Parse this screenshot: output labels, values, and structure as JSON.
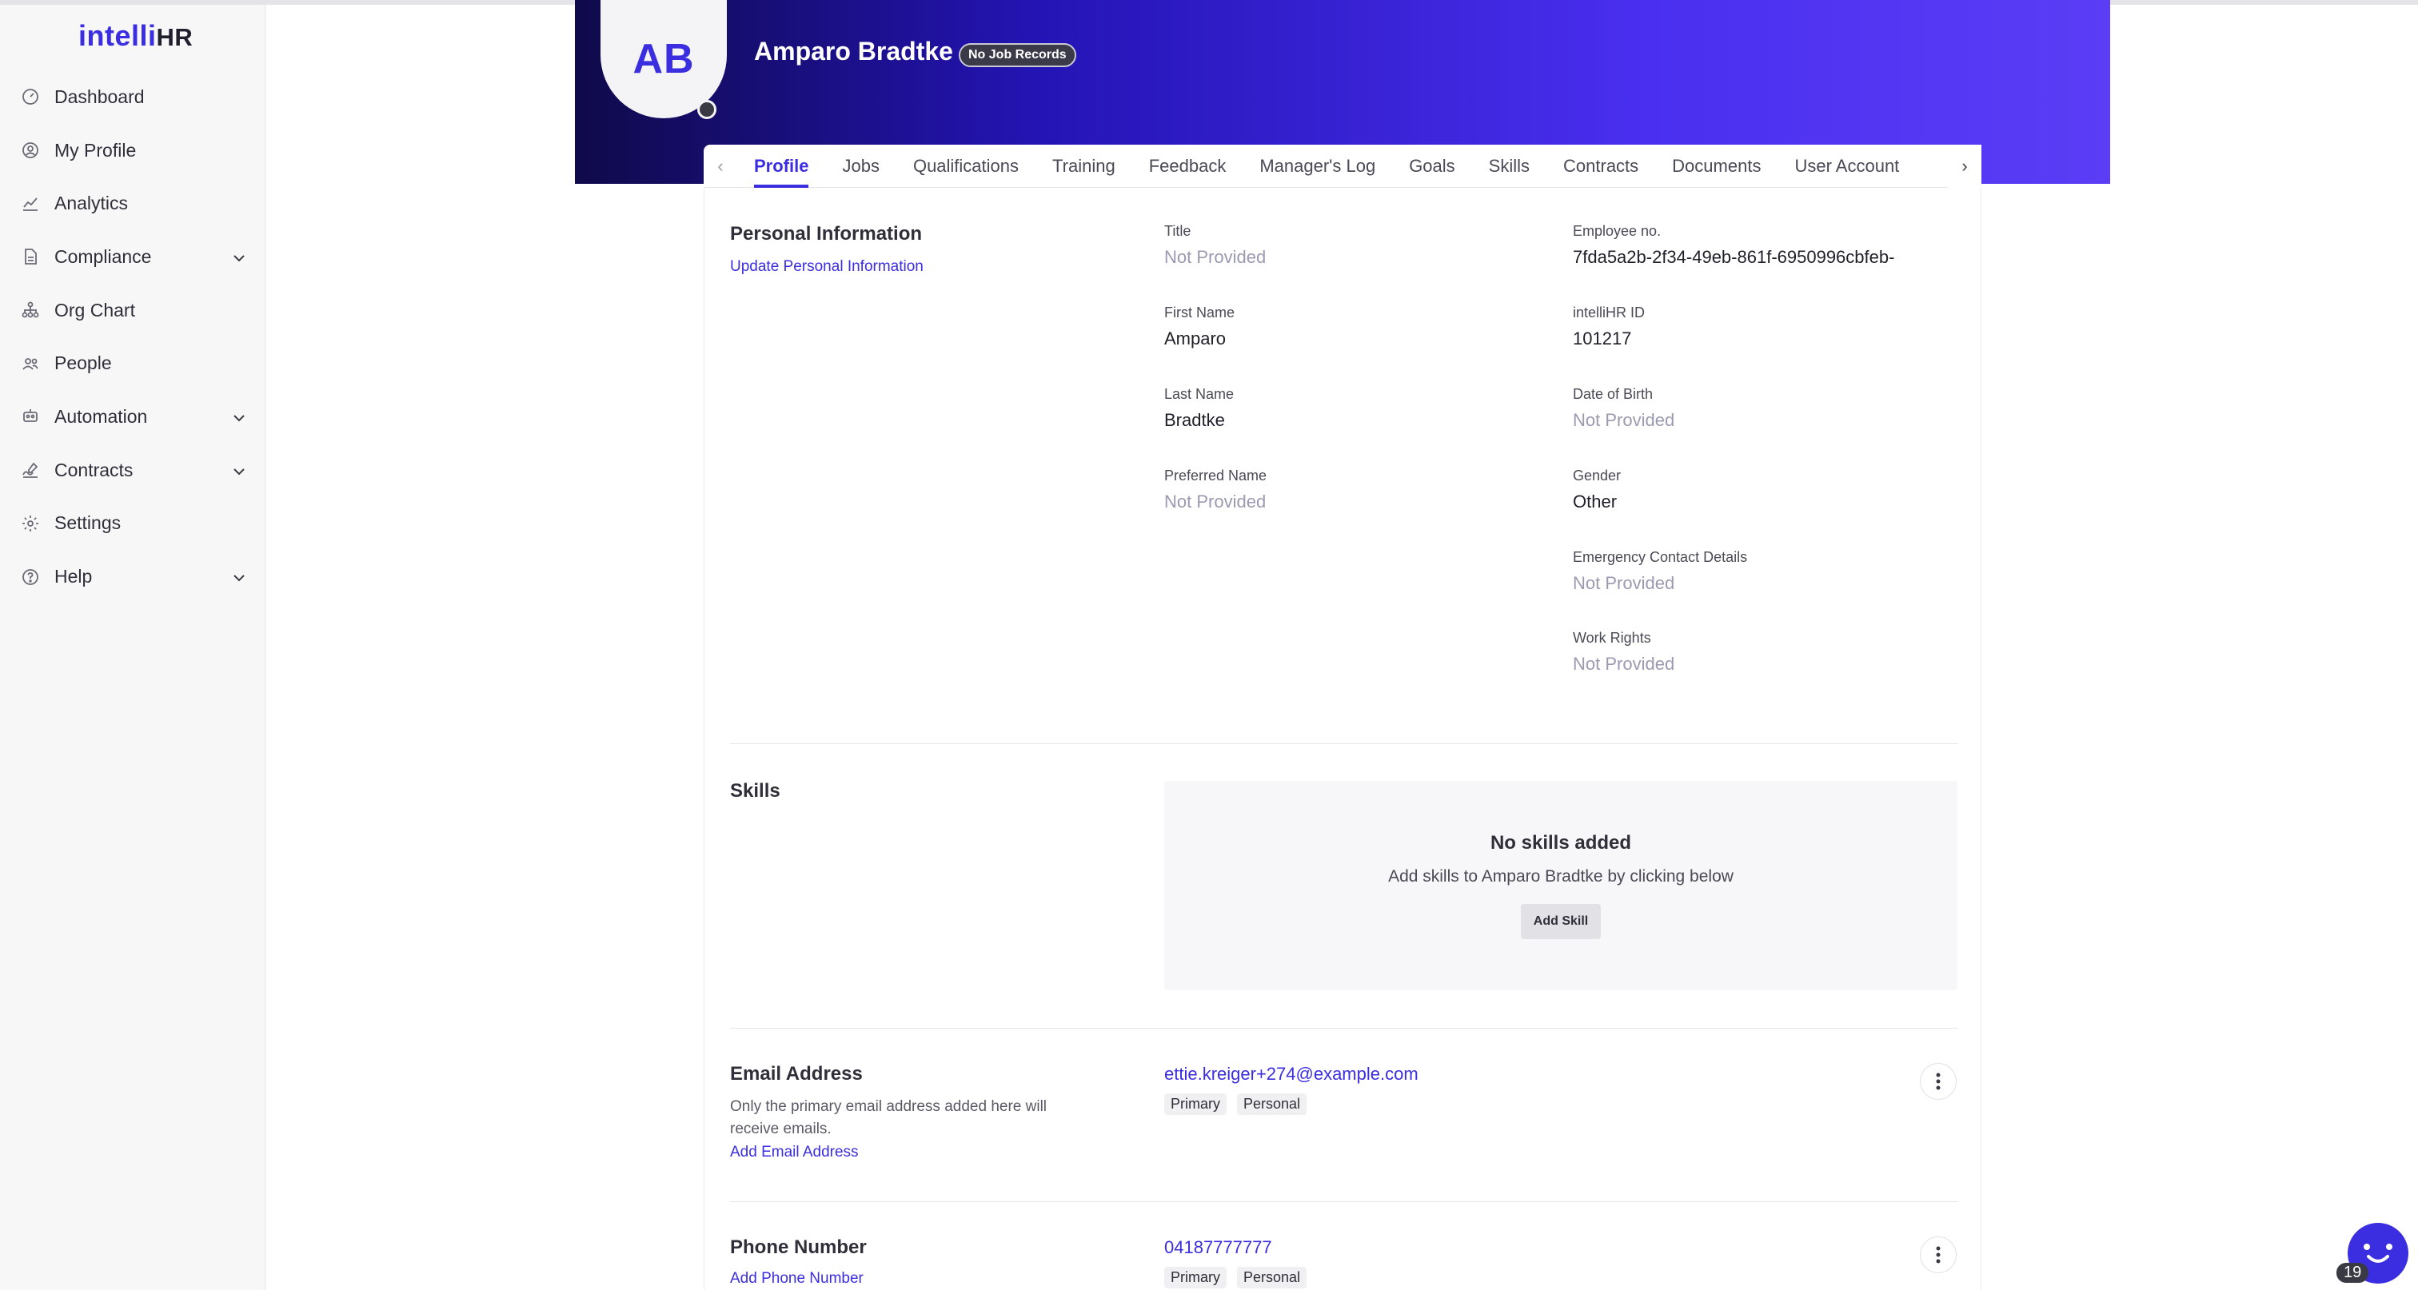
{
  "app": {
    "logo_primary": "intelli",
    "logo_secondary": "HR"
  },
  "sidebar": {
    "items": [
      {
        "label": "Dashboard",
        "icon": "dashboard-icon",
        "has_chevron": false
      },
      {
        "label": "My Profile",
        "icon": "user-circle-icon",
        "has_chevron": false
      },
      {
        "label": "Analytics",
        "icon": "analytics-icon",
        "has_chevron": false
      },
      {
        "label": "Compliance",
        "icon": "document-icon",
        "has_chevron": true
      },
      {
        "label": "Org Chart",
        "icon": "org-chart-icon",
        "has_chevron": false
      },
      {
        "label": "People",
        "icon": "people-icon",
        "has_chevron": false
      },
      {
        "label": "Automation",
        "icon": "automation-icon",
        "has_chevron": true
      },
      {
        "label": "Contracts",
        "icon": "contract-icon",
        "has_chevron": true
      },
      {
        "label": "Settings",
        "icon": "gear-icon",
        "has_chevron": false
      },
      {
        "label": "Help",
        "icon": "help-icon",
        "has_chevron": true
      }
    ]
  },
  "profile": {
    "initials": "AB",
    "name": "Amparo Bradtke",
    "badge": "No Job Records"
  },
  "tabs": {
    "items": [
      "Profile",
      "Jobs",
      "Qualifications",
      "Training",
      "Feedback",
      "Manager's Log",
      "Goals",
      "Skills",
      "Contracts",
      "Documents",
      "User Account"
    ],
    "active": "Profile"
  },
  "personal_info": {
    "title": "Personal Information",
    "update_link": "Update Personal Information",
    "left_fields": [
      {
        "label": "Title",
        "value": "Not Provided",
        "muted": true
      },
      {
        "label": "First Name",
        "value": "Amparo",
        "muted": false
      },
      {
        "label": "Last Name",
        "value": "Bradtke",
        "muted": false
      },
      {
        "label": "Preferred Name",
        "value": "Not Provided",
        "muted": true
      }
    ],
    "right_fields": [
      {
        "label": "Employee no.",
        "value": "7fda5a2b-2f34-49eb-861f-6950996cbfeb-",
        "muted": false
      },
      {
        "label": "intelliHR ID",
        "value": "101217",
        "muted": false
      },
      {
        "label": "Date of Birth",
        "value": "Not Provided",
        "muted": true
      },
      {
        "label": "Gender",
        "value": "Other",
        "muted": false
      },
      {
        "label": "Emergency Contact Details",
        "value": "Not Provided",
        "muted": true
      },
      {
        "label": "Work Rights",
        "value": "Not Provided",
        "muted": true
      }
    ]
  },
  "skills": {
    "title": "Skills",
    "empty_title": "No skills added",
    "empty_sub": "Add skills to Amparo Bradtke by clicking below",
    "add_button": "Add Skill"
  },
  "email": {
    "title": "Email Address",
    "helper": "Only the primary email address added here will receive emails.",
    "add_link": "Add Email Address",
    "value": "ettie.kreiger+274@example.com",
    "tags": [
      "Primary",
      "Personal"
    ]
  },
  "phone": {
    "title": "Phone Number",
    "add_link": "Add Phone Number",
    "value": "04187777777",
    "tags": [
      "Primary",
      "Personal"
    ]
  },
  "chat": {
    "badge_count": "19"
  },
  "colors": {
    "brand": "#3b2ee0",
    "banner_dark": "#0f0a4a",
    "banner_light": "#5a3df5"
  }
}
